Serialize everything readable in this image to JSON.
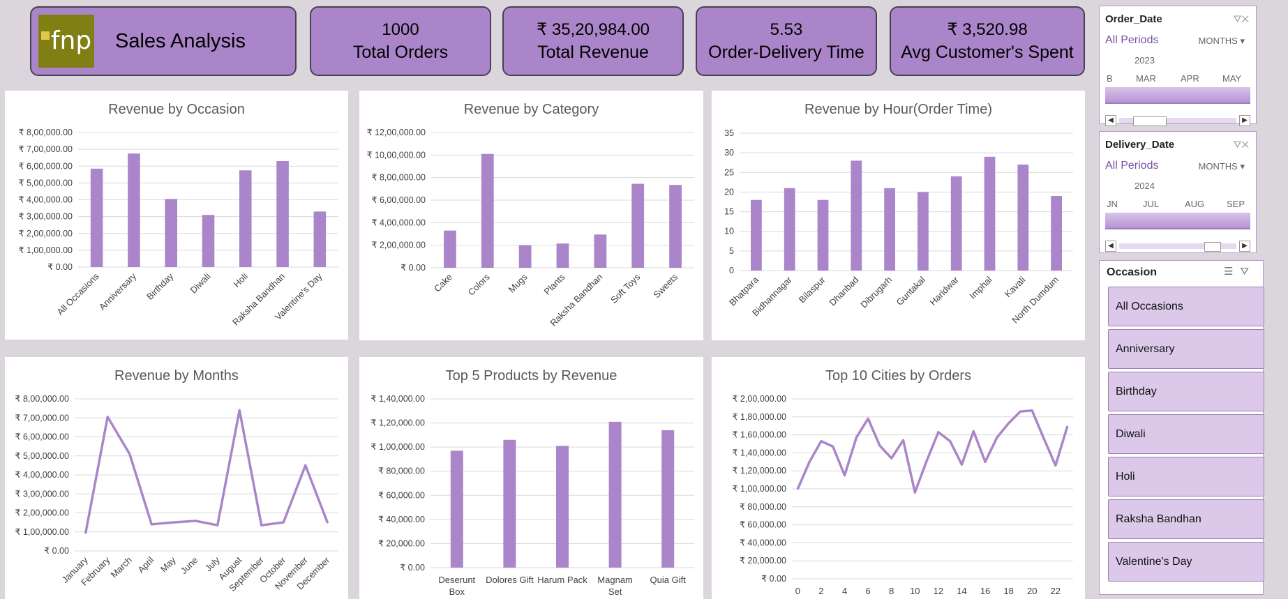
{
  "title": "Sales Analysis",
  "logo_text": "fnp",
  "kpis": [
    {
      "value": "1000",
      "label": "Total Orders"
    },
    {
      "value": "₹ 35,20,984.00",
      "label": "Total Revenue"
    },
    {
      "value": "5.53",
      "label": "Order-Delivery Time"
    },
    {
      "value": "₹ 3,520.98",
      "label": "Avg Customer's Spent"
    }
  ],
  "colors": {
    "accent": "#ab85c9",
    "bar": "#ab85c9",
    "background": "#dbd6db"
  },
  "slicers": {
    "order_date": {
      "header": "Order_Date",
      "period": "All Periods",
      "unit": "MONTHS",
      "year": "2023",
      "months": [
        "B",
        "MAR",
        "APR",
        "MAY"
      ]
    },
    "delivery_date": {
      "header": "Delivery_Date",
      "period": "All Periods",
      "unit": "MONTHS",
      "year": "2024",
      "months": [
        "JN",
        "JUL",
        "AUG",
        "SEP"
      ]
    },
    "occasion": {
      "header": "Occasion",
      "items": [
        "All Occasions",
        "Anniversary",
        "Birthday",
        "Diwali",
        "Holi",
        "Raksha Bandhan",
        "Valentine's Day"
      ]
    }
  },
  "chart_data": [
    {
      "type": "bar",
      "title": "Revenue by Occasion",
      "categories": [
        "All Occasions",
        "Anniversary",
        "Birthday",
        "Diwali",
        "Holi",
        "Raksha Bandhan",
        "Valentine's Day"
      ],
      "values": [
        585000,
        675000,
        405000,
        310000,
        575000,
        630000,
        330000
      ],
      "ylim": [
        0,
        800000
      ],
      "yticks": [
        "₹ 0.00",
        "₹ 1,00,000.00",
        "₹ 2,00,000.00",
        "₹ 3,00,000.00",
        "₹ 4,00,000.00",
        "₹ 5,00,000.00",
        "₹ 6,00,000.00",
        "₹ 7,00,000.00",
        "₹ 8,00,000.00"
      ]
    },
    {
      "type": "bar",
      "title": "Revenue by Category",
      "categories": [
        "Cake",
        "Colors",
        "Mugs",
        "Plants",
        "Raksha Bandhan",
        "Soft Toys",
        "Sweets"
      ],
      "values": [
        330000,
        1010000,
        200000,
        215000,
        295000,
        745000,
        735000
      ],
      "ylim": [
        0,
        1200000
      ],
      "yticks": [
        "₹ 0.00",
        "₹ 2,00,000.00",
        "₹ 4,00,000.00",
        "₹ 6,00,000.00",
        "₹ 8,00,000.00",
        "₹ 10,00,000.00",
        "₹ 12,00,000.00"
      ]
    },
    {
      "type": "bar",
      "title": "Revenue by Hour(Order Time)",
      "categories": [
        "Bhatpara",
        "Bidhannagar",
        "Bilaspur",
        "Dhanbad",
        "Dibrugarh",
        "Guntakal",
        "Haridwar",
        "Imphal",
        "Kavali",
        "North Dumdum"
      ],
      "values": [
        18,
        21,
        18,
        28,
        21,
        20,
        24,
        29,
        27,
        19
      ],
      "ylim": [
        0,
        35
      ],
      "yticks": [
        "0",
        "5",
        "10",
        "15",
        "20",
        "25",
        "30",
        "35"
      ]
    },
    {
      "type": "line",
      "title": "Revenue by Months",
      "categories": [
        "January",
        "February",
        "March",
        "April",
        "May",
        "June",
        "July",
        "August",
        "September",
        "October",
        "November",
        "December"
      ],
      "values": [
        95000,
        705000,
        510000,
        140000,
        150000,
        158000,
        135000,
        740000,
        135000,
        150000,
        450000,
        150000
      ],
      "ylim": [
        0,
        800000
      ],
      "yticks": [
        "₹ 0.00",
        "₹ 1,00,000.00",
        "₹ 2,00,000.00",
        "₹ 3,00,000.00",
        "₹ 4,00,000.00",
        "₹ 5,00,000.00",
        "₹ 6,00,000.00",
        "₹ 7,00,000.00",
        "₹ 8,00,000.00"
      ]
    },
    {
      "type": "bar",
      "title": "Top 5 Products by Revenue",
      "categories": [
        "Deserunt Box",
        "Dolores Gift",
        "Harum Pack",
        "Magnam Set",
        "Quia Gift"
      ],
      "values": [
        97000,
        106000,
        101000,
        121000,
        114000
      ],
      "ylim": [
        0,
        140000
      ],
      "yticks": [
        "₹ 0.00",
        "₹ 20,000.00",
        "₹ 40,000.00",
        "₹ 60,000.00",
        "₹ 80,000.00",
        "₹ 1,00,000.00",
        "₹ 1,20,000.00",
        "₹ 1,40,000.00"
      ]
    },
    {
      "type": "line",
      "title": "Top 10 Cities by Orders",
      "x": [
        0,
        1,
        2,
        3,
        4,
        5,
        6,
        7,
        8,
        9,
        10,
        11,
        12,
        13,
        14,
        15,
        16,
        17,
        18,
        19,
        20,
        21,
        22,
        23
      ],
      "values": [
        100000,
        130000,
        153000,
        147000,
        115000,
        157000,
        178000,
        148000,
        134000,
        154000,
        96000,
        131000,
        163000,
        153000,
        127000,
        164000,
        130000,
        157000,
        173000,
        186000,
        187000,
        156000,
        126000,
        169000
      ],
      "ylim": [
        0,
        200000
      ],
      "xticks": [
        "0",
        "2",
        "4",
        "6",
        "8",
        "10",
        "12",
        "14",
        "16",
        "18",
        "20",
        "22"
      ],
      "yticks": [
        "₹ 0.00",
        "₹ 20,000.00",
        "₹ 40,000.00",
        "₹ 60,000.00",
        "₹ 80,000.00",
        "₹ 1,00,000.00",
        "₹ 1,20,000.00",
        "₹ 1,40,000.00",
        "₹ 1,60,000.00",
        "₹ 1,80,000.00",
        "₹ 2,00,000.00"
      ]
    }
  ]
}
